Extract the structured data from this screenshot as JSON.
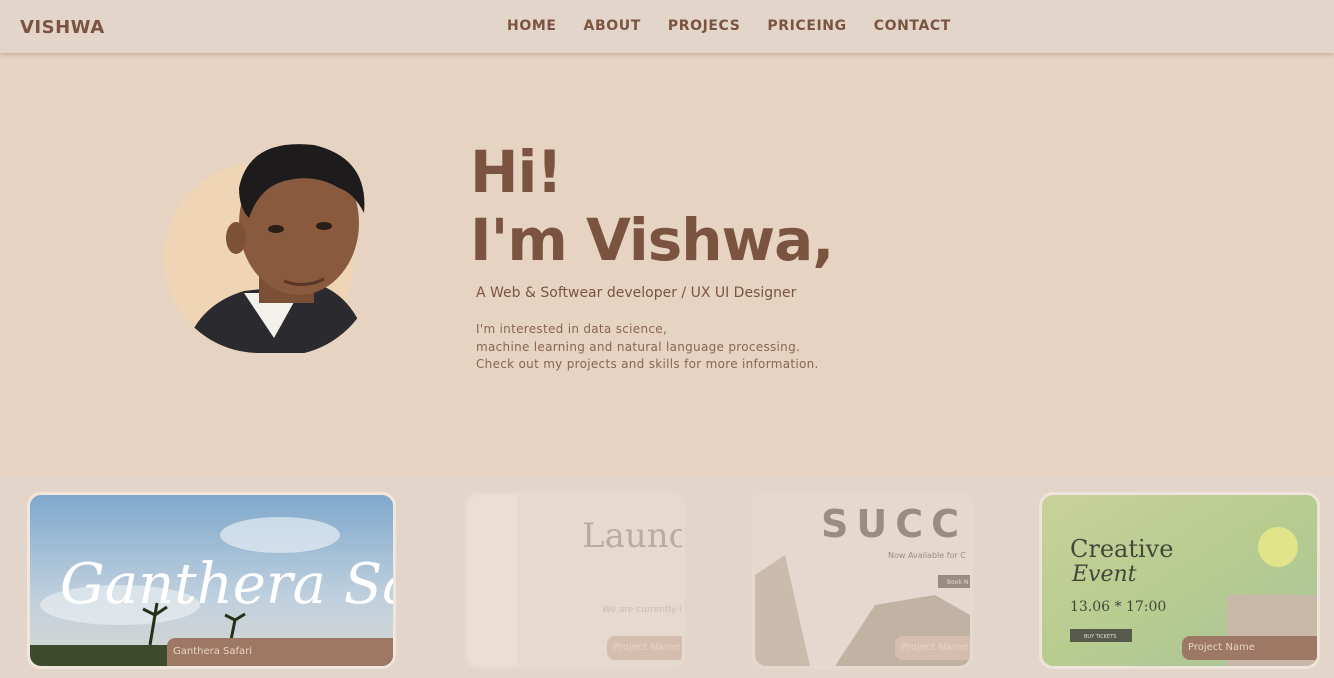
{
  "nav": {
    "logo": "VISHWA",
    "items": [
      "HOME",
      "ABOUT",
      "PROJECS",
      "PRICEING",
      "CONTACT"
    ]
  },
  "hero": {
    "greeting": "Hi!",
    "name": "I'm Vishwa,",
    "role": "A Web & Softwear developer / UX UI Designer",
    "bio": [
      "I'm interested in data science,",
      "machine learning and natural language processing.",
      "Check out my projects and skills for more information."
    ]
  },
  "projects": [
    {
      "title": "Ganthera Safari",
      "label": "Ganthera Safari"
    },
    {
      "title": "Launc soc",
      "subtitle": "We are currently improvements to",
      "label": "Project Name"
    },
    {
      "title": "SUCC",
      "subtitle": "Now Available for C",
      "button": "Book N",
      "label": "Project Name"
    },
    {
      "title": "Creative",
      "title2": "Event",
      "date": "13.06 * 17:00",
      "button": "BUY TICKETS",
      "label": "Project Name"
    }
  ],
  "colors": {
    "accent": "#7a5440",
    "background": "#e6d3c2",
    "nav_bg": "#e4d5ca",
    "label_bg": "#9c7865"
  }
}
